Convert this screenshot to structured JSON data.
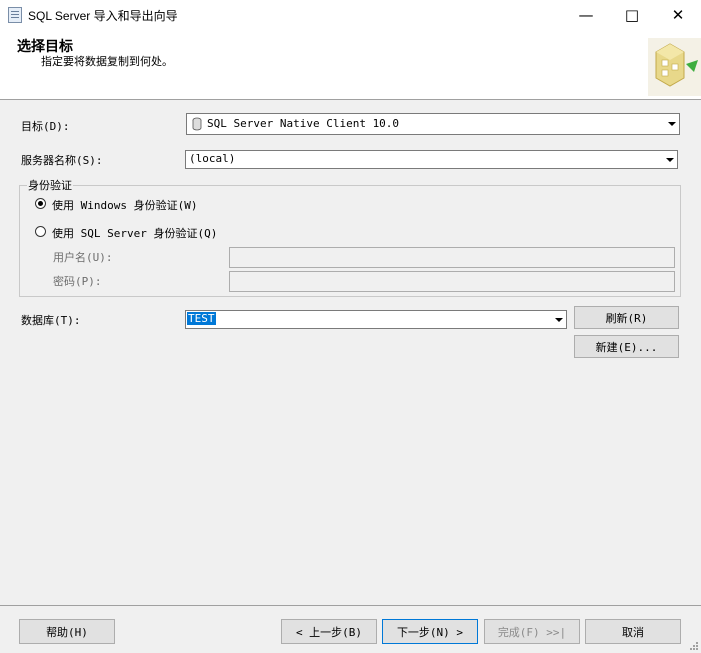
{
  "window": {
    "title": "SQL Server 导入和导出向导"
  },
  "header": {
    "title": "选择目标",
    "subtitle": "指定要将数据复制到何处。"
  },
  "form": {
    "destination": {
      "label": "目标(D):",
      "value": "SQL Server Native Client 10.0"
    },
    "server": {
      "label": "服务器名称(S):",
      "value": "(local)"
    },
    "auth": {
      "group_label": "身份验证",
      "windows_label": "使用 Windows 身份验证(W)",
      "sql_label": "使用 SQL Server 身份验证(Q)",
      "username_label": "用户名(U):",
      "password_label": "密码(P):"
    },
    "database": {
      "label": "数据库(T):",
      "value": "TEST",
      "refresh_label": "刷新(R)",
      "new_label": "新建(E)..."
    }
  },
  "footer": {
    "help": "帮助(H)",
    "back": "< 上一步(B)",
    "next": "下一步(N) >",
    "finish": "完成(F) >>|",
    "cancel": "取消"
  }
}
